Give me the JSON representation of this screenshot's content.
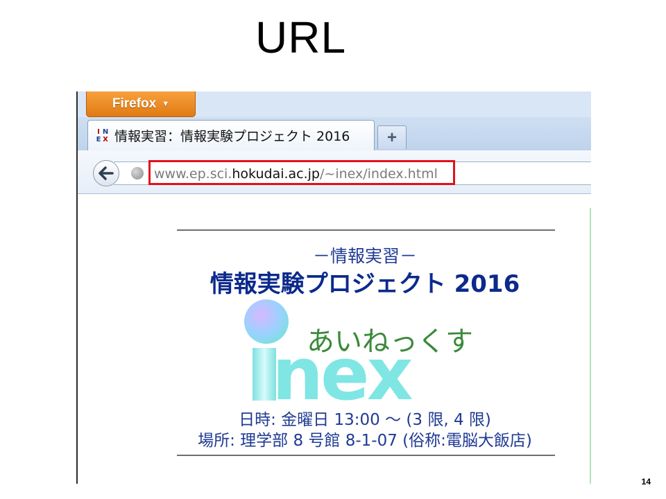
{
  "slide": {
    "title": "URL",
    "page_number": "14"
  },
  "browser": {
    "app_menu_label": "Firefox",
    "tab": {
      "favicon_letters": [
        "I",
        "N",
        "E",
        "X"
      ],
      "title": "情報実習：情報実験プロジェクト 2016"
    },
    "new_tab_label": "+",
    "address": {
      "prefix": "www.ep.sci.",
      "domain": "hokudai.ac.jp",
      "path": "/~inex/index.html",
      "highlight_color": "#e3101b"
    }
  },
  "page": {
    "subtitle": "－情報実習－",
    "heading": "情報実験プロジェクト 2016",
    "logo": {
      "word": "nex",
      "kana": "あいねっくす"
    },
    "schedule": "日時: 金曜日 13:00 ～ (3 限, 4 限)",
    "location": "場所: 理学部 8 号館 8-1-07 (俗称:電脳大飯店)"
  },
  "colors": {
    "firefox_orange": "#e88a23",
    "heading_blue": "#0c2a8c",
    "logo_cyan": "#7fe6e4",
    "logo_green": "#3a8a3a"
  }
}
